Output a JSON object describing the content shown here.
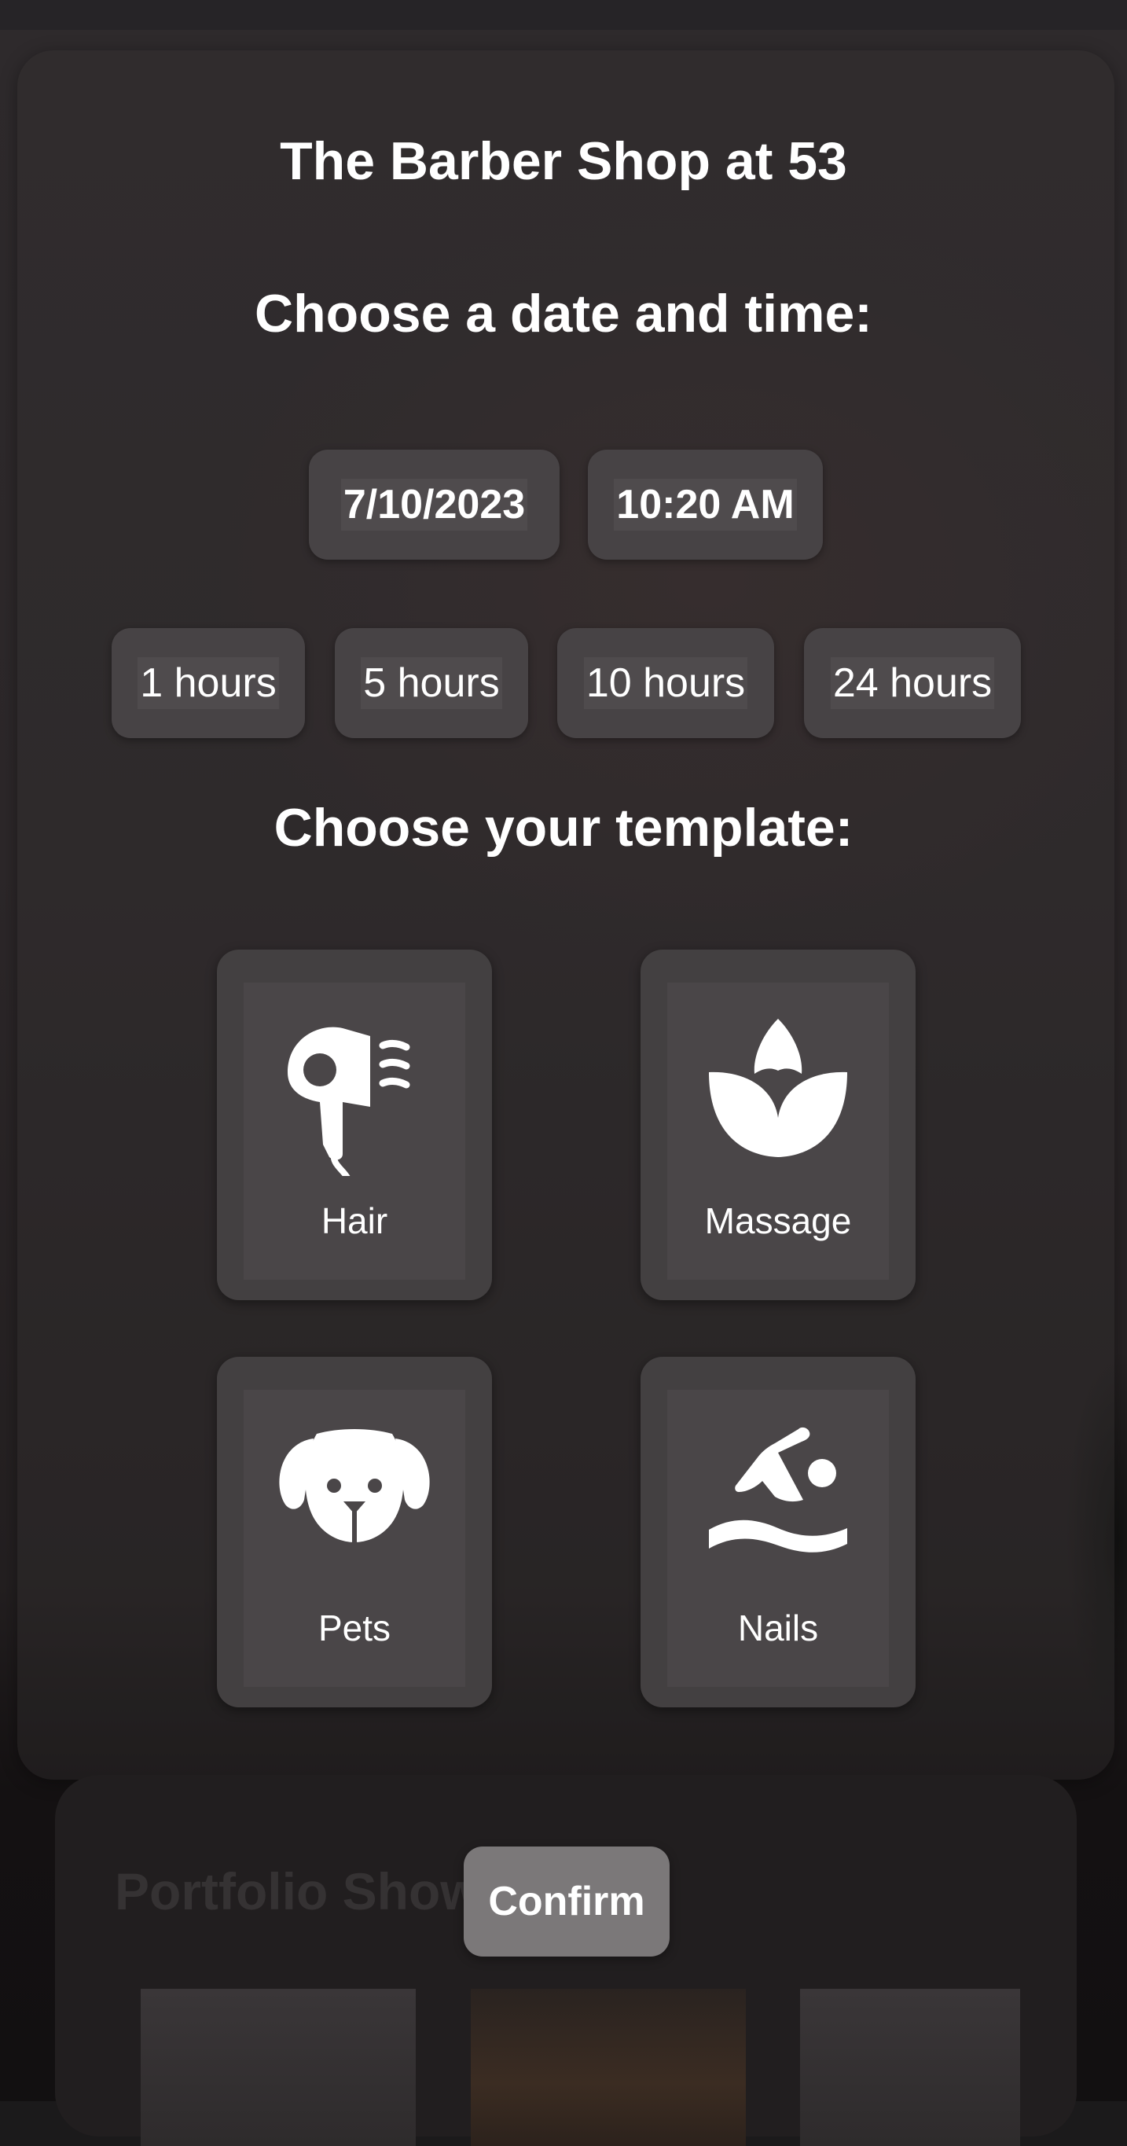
{
  "header": {
    "shop_name": "The Barber Shop at 53"
  },
  "datetime": {
    "heading": "Choose a date and time:",
    "date_value": "7/10/2023",
    "time_value": "10:20 AM"
  },
  "durations": [
    "1 hours",
    "5 hours",
    "10 hours",
    "24 hours"
  ],
  "templates": {
    "heading": "Choose your template:",
    "items": [
      {
        "label": "Hair",
        "icon": "hair-dryer-icon"
      },
      {
        "label": "Massage",
        "icon": "lotus-icon"
      },
      {
        "label": "Pets",
        "icon": "dog-icon"
      },
      {
        "label": "Nails",
        "icon": "swimmer-icon"
      }
    ]
  },
  "portfolio": {
    "title": "Portfolio Show"
  },
  "actions": {
    "confirm_label": "Confirm"
  },
  "colors": {
    "background": "#1b1a1b",
    "card": "#434041",
    "confirm_button": "#7b7879",
    "text": "#ffffff"
  }
}
